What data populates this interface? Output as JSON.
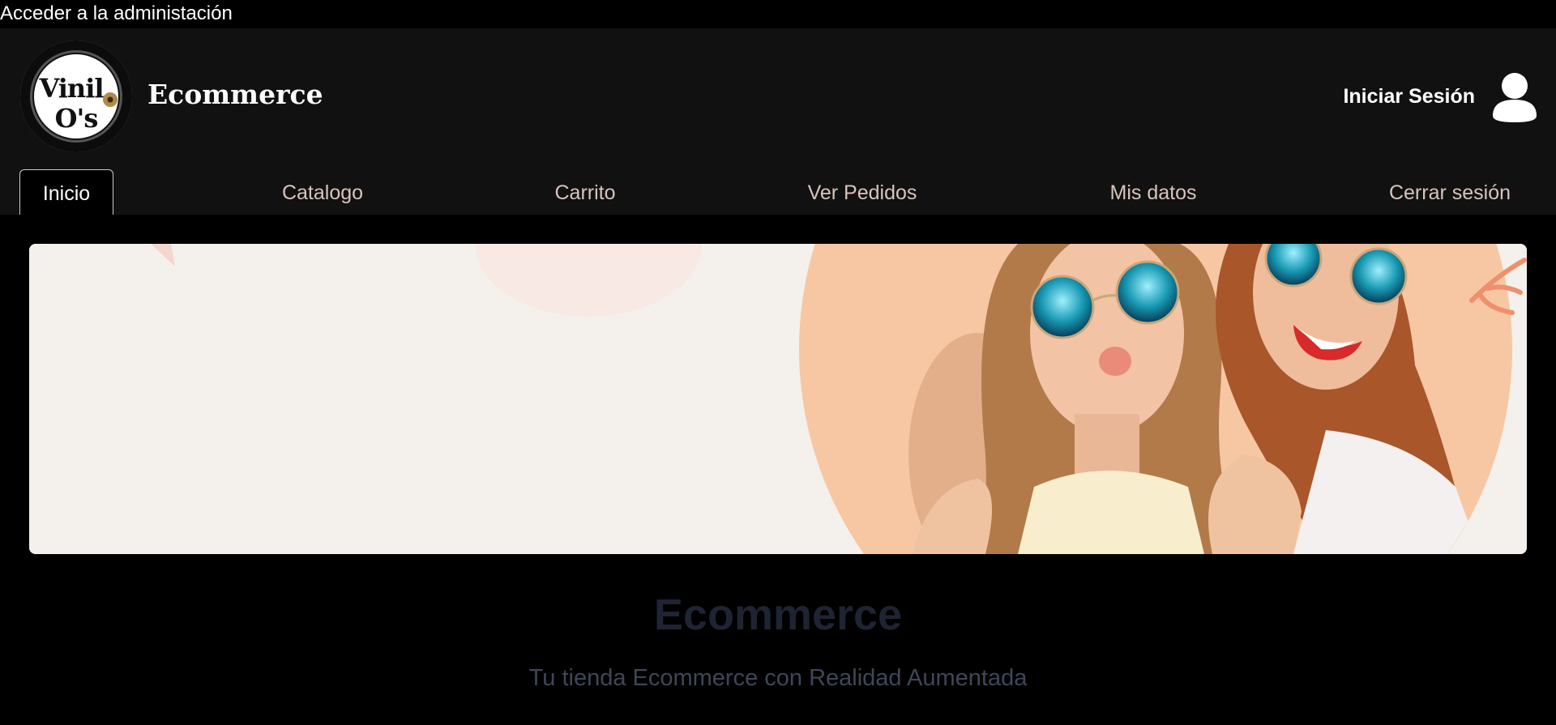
{
  "admin_link": "Acceder a la administación",
  "header": {
    "logo": {
      "line1": "Vinil",
      "line2": "O's"
    },
    "brand": "Ecommerce",
    "login_label": "Iniciar Sesión",
    "user_icon": "user-icon"
  },
  "nav": {
    "items": [
      {
        "label": "Inicio",
        "active": true
      },
      {
        "label": "Catalogo"
      },
      {
        "label": "Carrito"
      },
      {
        "label": "Ver Pedidos"
      },
      {
        "label": "Mis datos"
      },
      {
        "label": "Cerrar sesión"
      }
    ]
  },
  "hero": {
    "title": "Ecommerce",
    "subtitle": "Tu tienda Ecommerce con Realidad Aumentada"
  },
  "colors": {
    "page_bg": "#000000",
    "header_bg": "#111111",
    "nav_text": "#d9c3bc",
    "banner_bg": "#f4f1ec",
    "banner_peach": "#f7c7a4",
    "hero_title": "#1f2433",
    "hero_sub": "#3f4659"
  }
}
